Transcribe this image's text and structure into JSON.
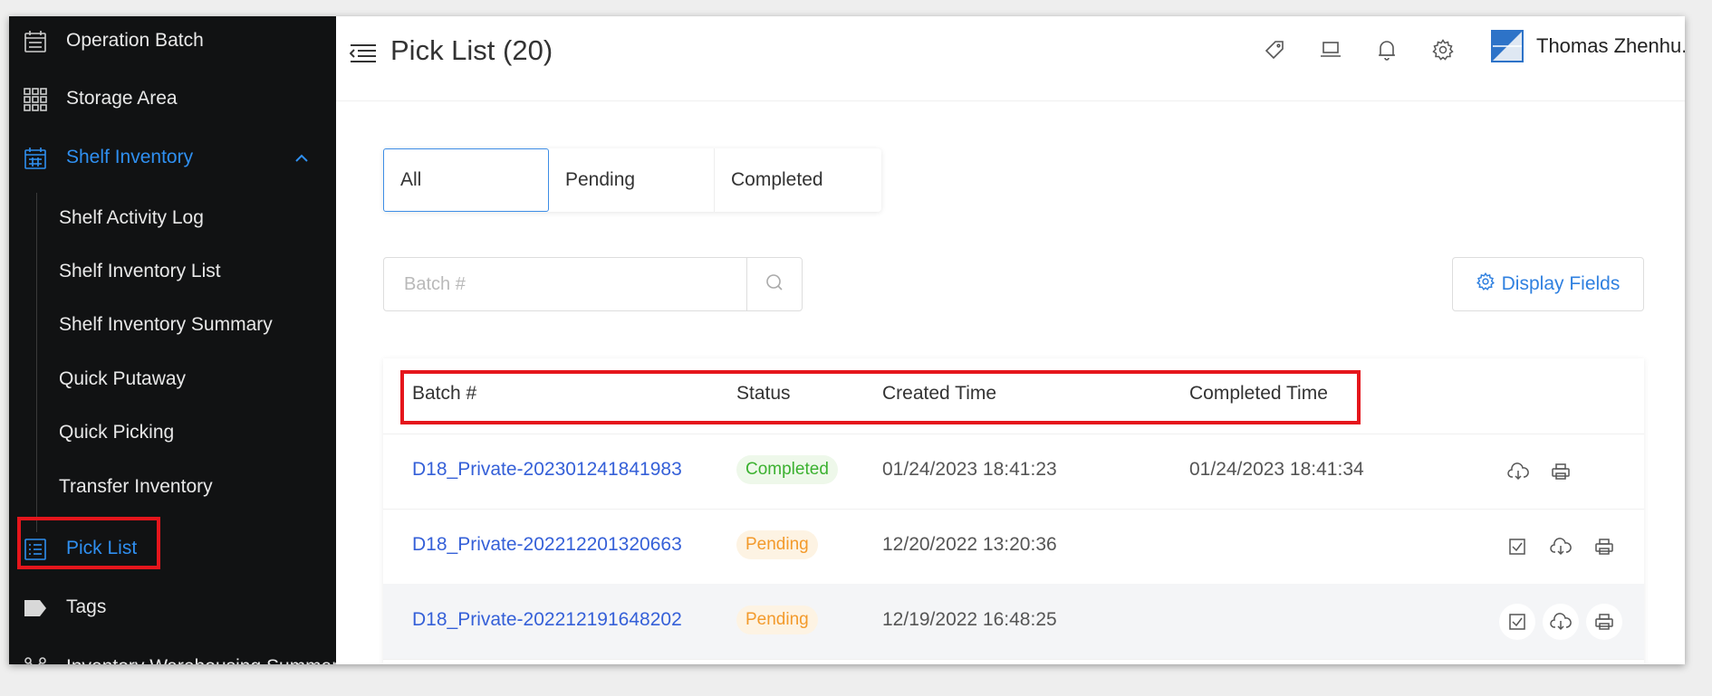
{
  "sidebar": {
    "items": [
      {
        "label": "Operation Batch",
        "icon": "calendar-icon"
      },
      {
        "label": "Storage Area",
        "icon": "grid-icon"
      },
      {
        "label": "Shelf Inventory",
        "icon": "calendar-grid-icon",
        "expanded": true
      },
      {
        "label": "Pick List",
        "icon": "list-icon",
        "active": true
      },
      {
        "label": "Tags",
        "icon": "tag-icon"
      },
      {
        "label": "Inventory Warehousing Summary",
        "icon": "branch-icon"
      }
    ],
    "sub_items": [
      {
        "label": "Shelf Activity Log"
      },
      {
        "label": "Shelf Inventory List"
      },
      {
        "label": "Shelf Inventory Summary"
      },
      {
        "label": "Quick Putaway"
      },
      {
        "label": "Quick Picking"
      },
      {
        "label": "Transfer Inventory"
      }
    ]
  },
  "header": {
    "title": "Pick List (20)",
    "user_name": "Thomas Zhenhu..",
    "icons": [
      "tag-icon",
      "laptop-icon",
      "bell-icon",
      "gear-icon"
    ]
  },
  "tabs": [
    {
      "label": "All",
      "active": true
    },
    {
      "label": "Pending"
    },
    {
      "label": "Completed"
    }
  ],
  "search": {
    "placeholder": "Batch #",
    "value": ""
  },
  "display_fields_label": "Display Fields",
  "table": {
    "columns": [
      "Batch #",
      "Status",
      "Created Time",
      "Completed Time"
    ],
    "rows": [
      {
        "batch": "D18_Private-202301241841983",
        "status": "Completed",
        "created": "01/24/2023 18:41:23",
        "completed": "01/24/2023 18:41:34",
        "actions": [
          "download-icon",
          "print-icon"
        ]
      },
      {
        "batch": "D18_Private-202212201320663",
        "status": "Pending",
        "created": "12/20/2022 13:20:36",
        "completed": "",
        "actions": [
          "checkbox-icon",
          "download-icon",
          "print-icon"
        ]
      },
      {
        "batch": "D18_Private-202212191648202",
        "status": "Pending",
        "created": "12/19/2022 16:48:25",
        "completed": "",
        "actions": [
          "checkbox-icon",
          "download-icon",
          "print-icon"
        ]
      }
    ]
  },
  "colors": {
    "sidebar_bg": "#111213",
    "accent": "#2f8ff0",
    "link": "#3560d8",
    "highlight_box": "#e5161c",
    "status_completed": "#3bb130",
    "status_pending": "#f39a2b"
  }
}
